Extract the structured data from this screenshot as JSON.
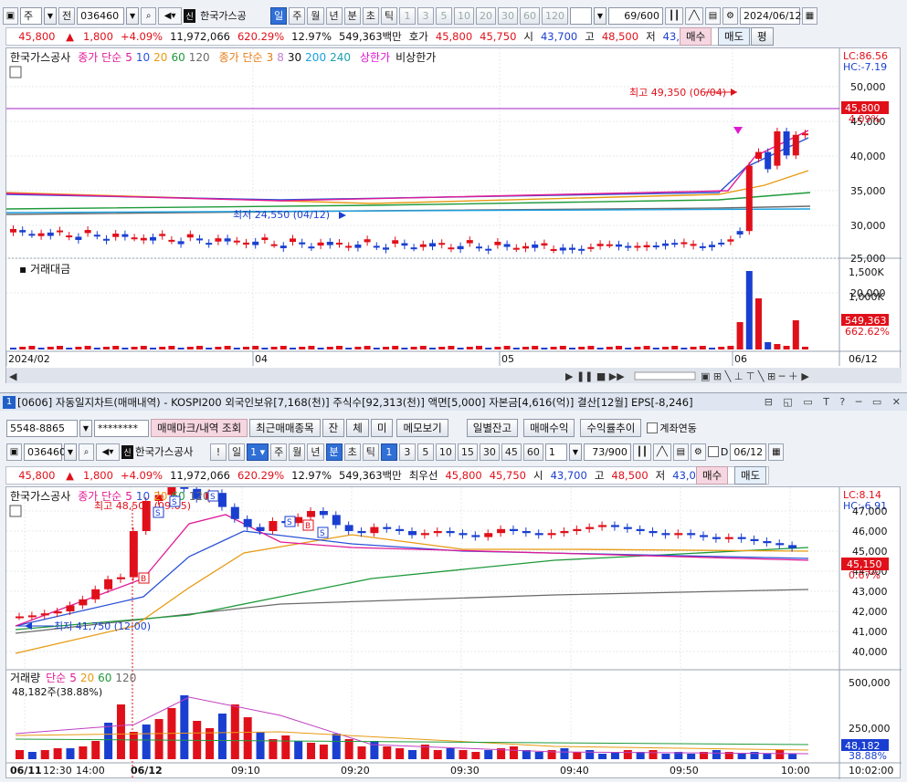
{
  "top": {
    "period": "주",
    "code": "036460",
    "name": "한국가스공",
    "tabs": [
      "일",
      "주",
      "월",
      "년",
      "분",
      "초",
      "틱"
    ],
    "nums": [
      "1",
      "3",
      "5",
      "10",
      "20",
      "30",
      "60",
      "120"
    ],
    "count": "69",
    "count_max": "/600",
    "date": "2024/06/12"
  },
  "quote": {
    "price": "45,800",
    "arrow": "▲",
    "change": "1,800",
    "pct": "+4.09%",
    "volume": "11,972,066",
    "vol_ratio": "620.29%",
    "turnover_rate": "12.97%",
    "amount": "549,363백만",
    "ask_label": "호가",
    "ask": "45,800",
    "bid": "45,750",
    "open_label": "시",
    "open": "43,700",
    "high_label": "고",
    "high": "48,500",
    "low_label": "저",
    "low": "43,050",
    "buy": "매수",
    "sell": "매도",
    "avg": "평"
  },
  "chart1": {
    "legend": {
      "name": "한국가스공사",
      "ma_label": "종가 단순",
      "ma_periods": [
        "5",
        "10",
        "20",
        "60",
        "120"
      ],
      "ma2_label": "종가 단순",
      "ma2_periods": [
        "3",
        "8",
        "30",
        "200",
        "240"
      ],
      "limit_up": "상한가",
      "limit_down": "비상한가"
    },
    "lc": "LC:86.56",
    "hc": "HC:-7.19",
    "y_ticks": [
      "50,000",
      "45,000",
      "40,000",
      "35,000",
      "30,000",
      "25,000",
      "20,000"
    ],
    "price_box": "45,800",
    "price_pct": "4.09%",
    "high_note": "최고 49,350 (06/04)",
    "low_note": "최저 24,550 (04/12)",
    "vol_title": "거래대금",
    "vol_ticks": [
      "1,500K",
      "1,000K",
      "500K"
    ],
    "vol_box": "549,363",
    "vol_pct": "662.62%",
    "x_labels": [
      "2024/02",
      "04",
      "05",
      "06"
    ],
    "x_end": "06/12"
  },
  "win": {
    "num": "1",
    "title": "[0606] 자동일지차트(매매내역) - KOSPI200 외국인보유[7,168(천)] 주식수[92,313(천)] 액면[5,000] 자본금[4,616(억)] 결산[12월] EPS[-8,246]"
  },
  "acct": {
    "number": "5548-8865",
    "password": "********",
    "b1": "매매마크/내역 조회",
    "b2": "최근매매종목",
    "b3": "잔",
    "b4": "체",
    "b5": "미",
    "b6": "메모보기",
    "b7": "일별잔고",
    "b8": "매매수익",
    "b9": "수익률추이",
    "chk": "계좌연동"
  },
  "top2": {
    "code": "036460",
    "name": "한국가스공사",
    "tabs": [
      "일",
      "주",
      "월",
      "년",
      "분",
      "초",
      "틱"
    ],
    "nums": [
      "1",
      "3",
      "5",
      "10",
      "15",
      "30",
      "45",
      "60"
    ],
    "interval": "1",
    "count": "73",
    "count_max": "/900",
    "d": "D",
    "date": "06/12"
  },
  "quote2": {
    "price": "45,800",
    "arrow": "▲",
    "change": "1,800",
    "pct": "+4.09%",
    "volume": "11,972,066",
    "vol_ratio": "620.29%",
    "turnover_rate": "12.97%",
    "amount": "549,363백만",
    "ask_label": "최우선",
    "ask": "45,800",
    "bid": "45,750",
    "open_label": "시",
    "open": "43,700",
    "high_label": "고",
    "high": "48,500",
    "low_label": "저",
    "low": "43,050",
    "buy": "매수",
    "sell": "매도"
  },
  "chart2": {
    "legend": {
      "name": "한국가스공사",
      "ma_label": "종가 단순",
      "ma_periods": [
        "5",
        "10",
        "20",
        "60",
        "120"
      ]
    },
    "lc": "LC:8.14",
    "hc": "HC:-6.91",
    "y_ticks": [
      "47,000",
      "46,000",
      "45,000",
      "44,000",
      "43,000",
      "42,000",
      "41,000",
      "40,000"
    ],
    "price_box": "45,150",
    "price_pct": "0.67%",
    "high_note": "최고 48,500 (09:05)",
    "low_note": "최저 41,750 (12:00)",
    "vol_title": "거래량",
    "vol_ma_label": "단순",
    "vol_ma_periods": [
      "5",
      "20",
      "60",
      "120"
    ],
    "vol_note": "48,182주(38.88%)",
    "vol_ticks": [
      "500,000",
      "250,000"
    ],
    "vol_box": "48,182",
    "vol_pct": "38.88%",
    "x_labels": [
      "06/11",
      "12:30",
      "14:00",
      "06/12",
      "09:10",
      "09:20",
      "09:30",
      "09:40",
      "09:50",
      "10:00"
    ],
    "x_end": "10:02:00"
  },
  "colors": {
    "up": "#e0101a",
    "down": "#1a3fd0",
    "ma5": "#e01a96",
    "ma10": "#2a52d6",
    "ma20": "#e89a12",
    "ma60": "#1e9a3a",
    "ma120": "#6b6b6b"
  }
}
